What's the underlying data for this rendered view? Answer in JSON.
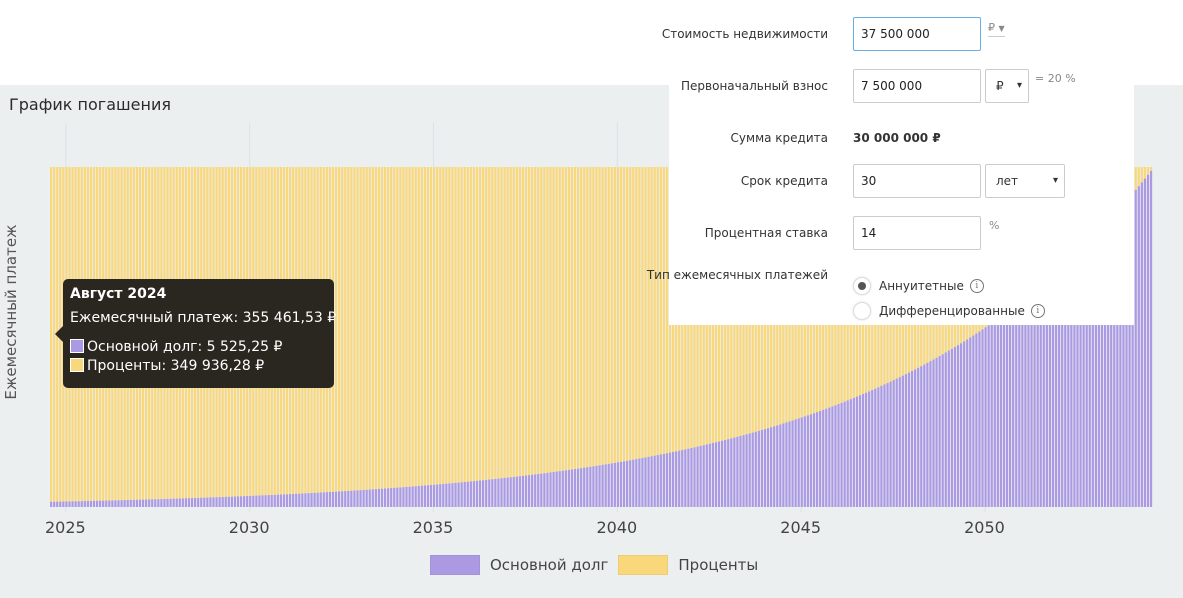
{
  "chart": {
    "title": "График погашения",
    "ylabel": "Ежемесячный платеж"
  },
  "chart_data": {
    "type": "bar",
    "stacked": true,
    "series": [
      {
        "name": "Основной долг",
        "color": "#ab9ae3"
      },
      {
        "name": "Проценты",
        "color": "#f9d77b"
      }
    ],
    "monthly_payment": 355461.53,
    "first_principal": 5525.25,
    "first_interest": 349936.28,
    "annual_rate_percent": 14,
    "term_months": 360,
    "start": "Август 2024",
    "x_ticks": [
      "2025",
      "2030",
      "2035",
      "2040",
      "2045",
      "2050"
    ],
    "grid": true
  },
  "legend": {
    "principal_label": "Основной долг",
    "interest_label": "Проценты"
  },
  "tooltip": {
    "title": "Август 2024",
    "payment": "Ежемесячный платеж: 355 461,53 ₽",
    "principal": "Основной долг: 5 525,25 ₽",
    "interest": "Проценты: 349 936,28 ₽"
  },
  "calculator": {
    "price_label": "Стоимость недвижимости",
    "price_value": "37 500 000",
    "price_currency": "₽",
    "down_label": "Первоначальный взнос",
    "down_value": "7 500 000",
    "down_unit": "₽",
    "down_percent": "= 20 %",
    "loan_label": "Сумма кредита",
    "loan_value": "30 000 000 ₽",
    "term_label": "Срок кредита",
    "term_value": "30",
    "term_unit": "лет",
    "rate_label": "Процентная ставка",
    "rate_value": "14",
    "rate_unit": "%",
    "type_label": "Тип ежемесячных платежей",
    "type_annuity": "Аннуитетные",
    "type_diff": "Дифференцированные"
  },
  "colors": {
    "principal": "#ab9ae3",
    "interest": "#f9d77b",
    "background": "#ebeff0",
    "tooltip_bg": "#2a2721"
  }
}
